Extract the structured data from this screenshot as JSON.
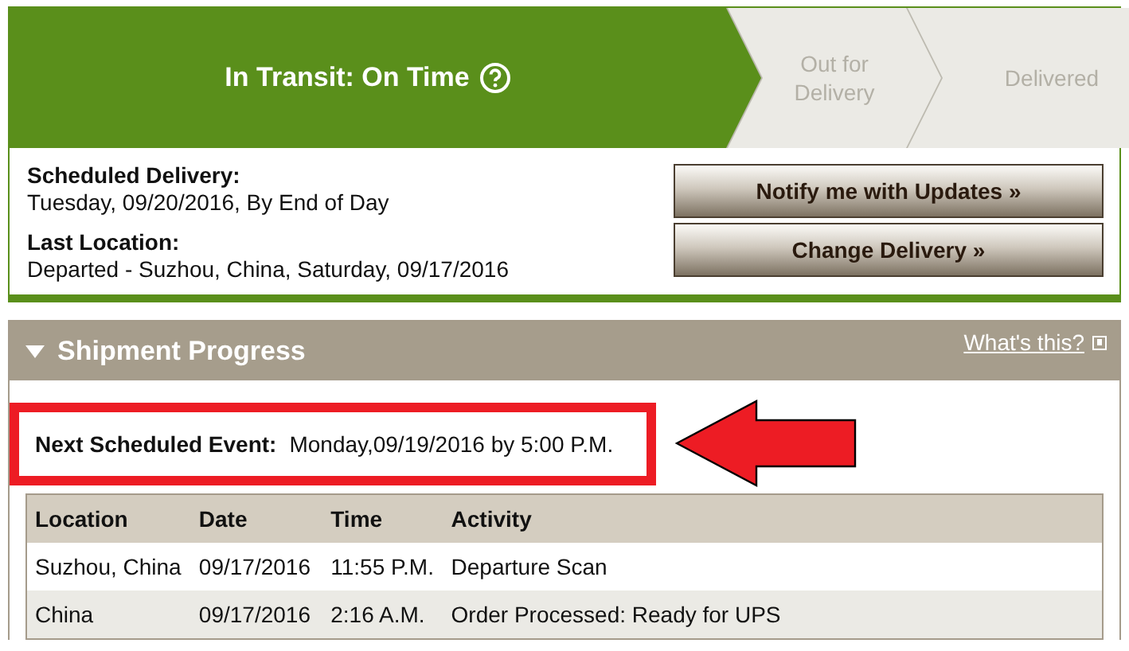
{
  "status_steps": [
    {
      "label": "In Transit: On Time",
      "selected": true,
      "help": true
    },
    {
      "label": "Out for Delivery",
      "selected": false,
      "help": false
    },
    {
      "label": "Delivered",
      "selected": false,
      "help": false
    }
  ],
  "details": [
    {
      "label": "Scheduled Delivery:",
      "value": "Tuesday, 09/20/2016, By End of Day"
    },
    {
      "label": "Last Location:",
      "value": "Departed - Suzhou, China, Saturday, 09/17/2016"
    }
  ],
  "buttons": [
    "Notify me with Updates »",
    "Change Delivery »"
  ],
  "progress": {
    "title": "Shipment Progress",
    "expanded": true,
    "help_link": "What's this?",
    "next_event": {
      "label": "Next Scheduled Event:",
      "value": "Monday,09/19/2016 by 5:00 P.M."
    },
    "columns": [
      "Location",
      "Date",
      "Time",
      "Activity"
    ],
    "rows": [
      [
        "Suzhou, China",
        "09/17/2016",
        "11:55 P.M.",
        "Departure Scan"
      ],
      [
        "China",
        "09/17/2016",
        "2:16 A.M.",
        "Order Processed: Ready for UPS"
      ]
    ]
  }
}
